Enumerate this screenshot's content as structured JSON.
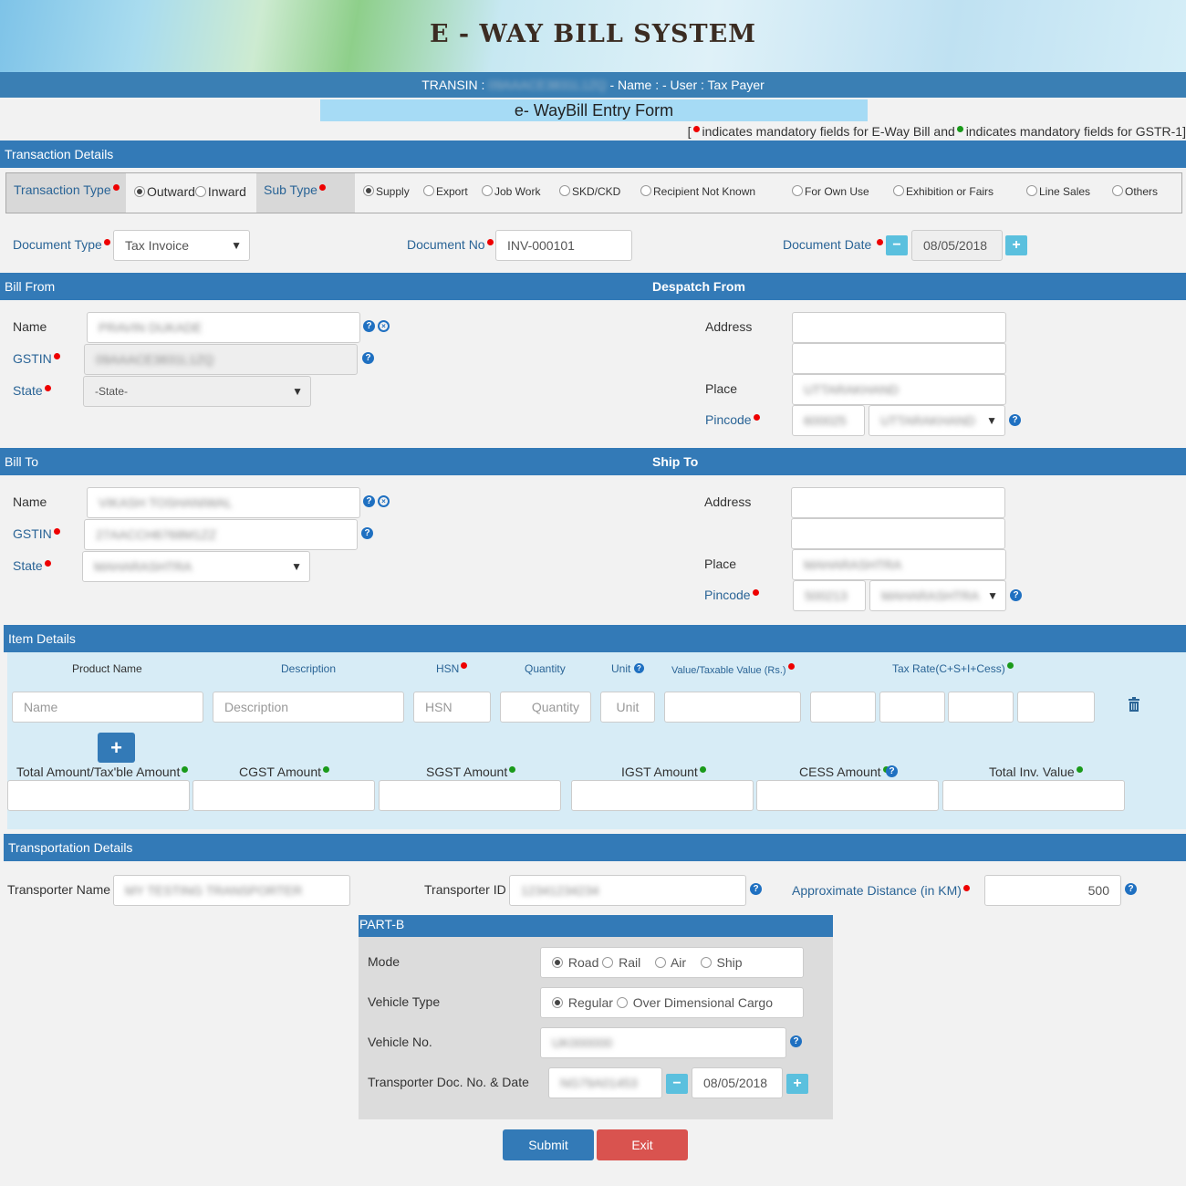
{
  "header": {
    "title": "E - WAY BILL SYSTEM"
  },
  "userbar": {
    "prefix": "TRANSIN :",
    "gstin": "09AAACE3831L1ZQ",
    "rest": "- Name : - User : Tax Payer"
  },
  "form": {
    "title": "e- WayBill Entry Form"
  },
  "legend": {
    "open": "[",
    "text1": "indicates mandatory fields for E-Way Bill and",
    "text2": "indicates mandatory fields for GSTR-1]"
  },
  "transaction": {
    "section_title": "Transaction Details",
    "type_label": "Transaction Type",
    "outward": "Outward",
    "inward": "Inward",
    "subtype_label": "Sub Type",
    "subtypes": [
      "Supply",
      "Export",
      "Job Work",
      "SKD/CKD",
      "Recipient Not Known",
      "For Own Use",
      "Exhibition or Fairs",
      "Line Sales",
      "Others"
    ],
    "doc_type_label": "Document Type",
    "doc_type_value": "Tax Invoice",
    "doc_no_label": "Document No",
    "doc_no_value": "INV-000101",
    "doc_date_label": "Document Date",
    "doc_date_value": "08/05/2018"
  },
  "bill_from": {
    "section_title": "Bill From",
    "despatch_title": "Despatch From",
    "name_label": "Name",
    "name_value": "PRAVIN DUKADE",
    "gstin_label": "GSTIN",
    "gstin_value": "09AAACE3831L1ZQ",
    "state_label": "State",
    "state_value": "-State-",
    "address_label": "Address",
    "place_label": "Place",
    "place_value": "UTTARAKHAND",
    "pincode_label": "Pincode",
    "pincode_value": "600025",
    "pin_state_value": "UTTARAKHAND"
  },
  "bill_to": {
    "section_title": "Bill To",
    "ship_title": "Ship To",
    "name_label": "Name",
    "name_value": "VIKASH TOSHANIWAL",
    "gstin_label": "GSTIN",
    "gstin_value": "27AACCH6768M1ZZ",
    "state_label": "State",
    "state_value": "MAHARASHTRA",
    "address_label": "Address",
    "place_label": "Place",
    "place_value": "MAHARASHTRA",
    "pincode_label": "Pincode",
    "pincode_value": "500213",
    "pin_state_value": "MAHARASHTRA"
  },
  "items": {
    "section_title": "Item Details",
    "headers": {
      "product": "Product Name",
      "description": "Description",
      "hsn": "HSN",
      "quantity": "Quantity",
      "unit": "Unit",
      "value": "Value/Taxable Value (Rs.)",
      "tax": "Tax Rate(C+S+I+Cess)"
    },
    "placeholders": {
      "name": "Name",
      "description": "Description",
      "hsn": "HSN",
      "quantity": "Quantity",
      "unit": "Unit"
    },
    "add_symbol": "+",
    "totals": {
      "total": "Total Amount/Tax'ble Amount",
      "cgst": "CGST Amount",
      "sgst": "SGST Amount",
      "igst": "IGST Amount",
      "cess": "CESS Amount",
      "inv": "Total Inv. Value"
    }
  },
  "transport": {
    "section_title": "Transportation Details",
    "name_label": "Transporter Name",
    "name_value": "MY TESTING TRANSPORTER",
    "id_label": "Transporter ID",
    "id_value": "12341234234",
    "distance_label": "Approximate Distance (in KM)",
    "distance_value": "500"
  },
  "partb": {
    "title": "PART-B",
    "mode_label": "Mode",
    "modes": [
      "Road",
      "Rail",
      "Air",
      "Ship"
    ],
    "vehicle_type_label": "Vehicle Type",
    "vehicle_types": [
      "Regular",
      "Over Dimensional Cargo"
    ],
    "vehicle_no_label": "Vehicle No.",
    "vehicle_no_value": "UK000000",
    "doc_label": "Transporter Doc. No. & Date",
    "doc_no_value": "NG79A01453",
    "doc_date_value": "08/05/2018"
  },
  "actions": {
    "submit": "Submit",
    "exit": "Exit"
  },
  "colors": {
    "primary": "#337ab7",
    "danger": "#d9534f",
    "info": "#5bc0de",
    "required": "#e00000",
    "gstr": "#1a9a1a"
  }
}
